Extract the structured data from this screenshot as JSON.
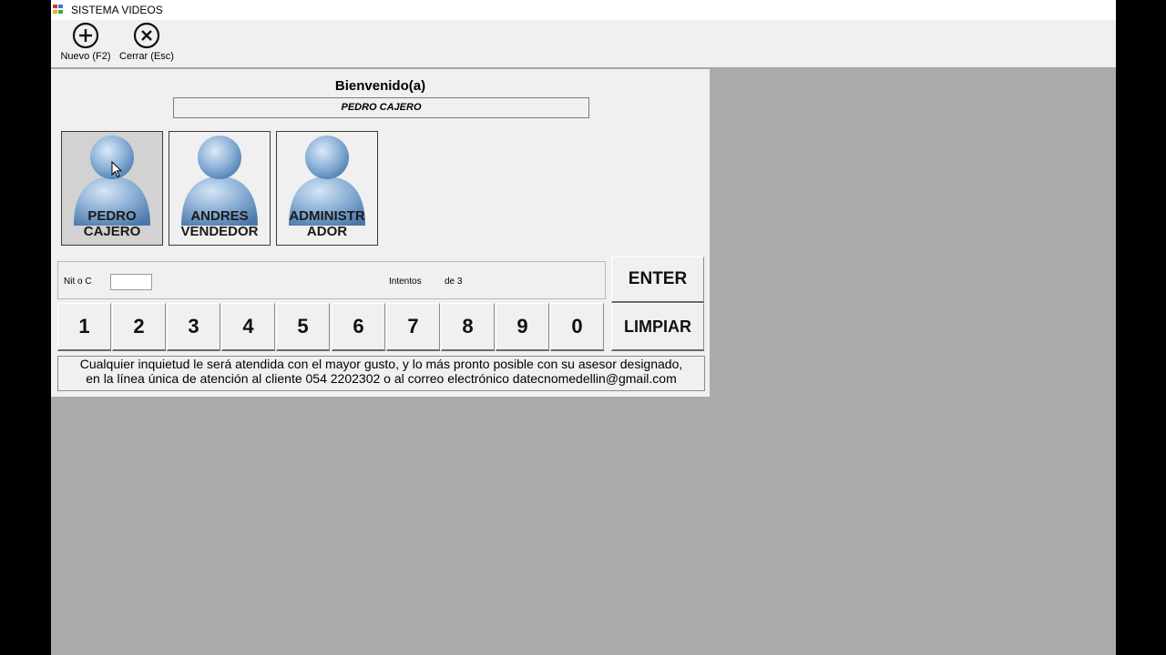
{
  "window": {
    "title": "SISTEMA VIDEOS"
  },
  "toolbar": {
    "nuevo_label": "Nuevo (F2)",
    "cerrar_label": "Cerrar (Esc)"
  },
  "login": {
    "welcome": "Bienvenido(a)",
    "selected_user": "PEDRO CAJERO",
    "users": [
      {
        "line1": "PEDRO",
        "line2": "CAJERO",
        "selected": true
      },
      {
        "line1": "ANDRES",
        "line2": "VENDEDOR",
        "selected": false
      },
      {
        "line1": "ADMINISTR",
        "line2": "ADOR",
        "selected": false
      }
    ],
    "nit_label": "Nit o C",
    "nit_value": "",
    "intentos_label": "Intentos",
    "intentos_value": "de 3",
    "keypad": [
      "1",
      "2",
      "3",
      "4",
      "5",
      "6",
      "7",
      "8",
      "9",
      "0"
    ],
    "enter_label": "ENTER",
    "limpiar_label": "LIMPIAR",
    "footer_line1": "Cualquier inquietud le será atendida con el mayor gusto, y lo más pronto posible con su asesor designado,",
    "footer_line2": "en la línea única de atención al cliente 054 2202302 o al correo electrónico datecnomedellin@gmail.com"
  },
  "colors": {
    "window_bg": "#ababab",
    "panel_bg": "#f0f0f0",
    "avatar_blue": "#8fb3d9",
    "selected_tile": "#d2d2d2"
  },
  "icons": [
    "app-icon",
    "add-circle-icon",
    "close-circle-icon",
    "user-avatar-icon",
    "mouse-cursor-icon"
  ]
}
